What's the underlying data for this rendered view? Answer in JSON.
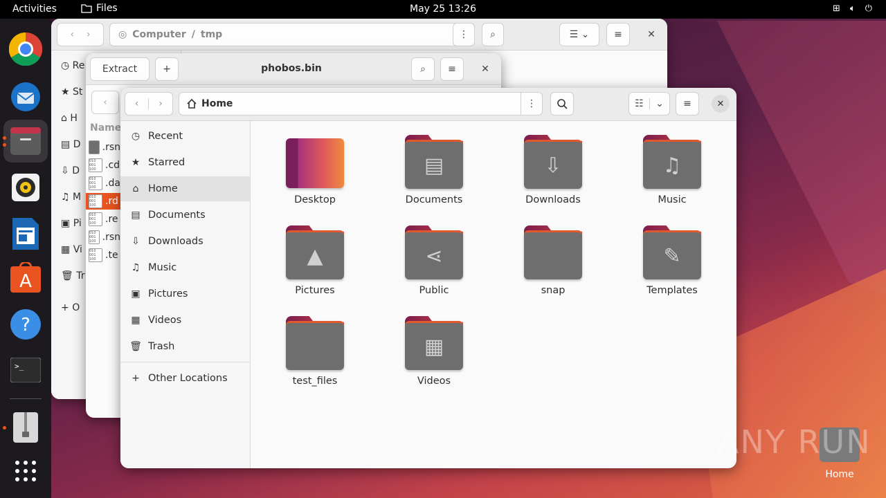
{
  "topbar": {
    "activities": "Activities",
    "app_name": "Files",
    "clock": "May 25  13:26"
  },
  "dock": {
    "items": [
      {
        "name": "chrome"
      },
      {
        "name": "thunderbird"
      },
      {
        "name": "files"
      },
      {
        "name": "rhythmbox"
      },
      {
        "name": "libreoffice-writer"
      },
      {
        "name": "app-center"
      },
      {
        "name": "help"
      },
      {
        "name": "terminal"
      },
      {
        "name": "archive-manager"
      },
      {
        "name": "show-apps"
      }
    ]
  },
  "back_window": {
    "path": [
      "Computer",
      "tmp"
    ],
    "sidebar_partial": [
      "Re",
      "St",
      "H",
      "D",
      "D",
      "M",
      "Pi",
      "Vi",
      "Tr",
      "O"
    ]
  },
  "archive_window": {
    "extract_label": "Extract",
    "title": "phobos.bin",
    "column_header": "Name",
    "files": [
      ".rsn",
      ".cd",
      ".da",
      ".rd",
      ".re",
      ".rsn",
      ".te"
    ]
  },
  "files_window": {
    "location": "Home",
    "sidebar": [
      {
        "label": "Recent",
        "icon": "recent-icon"
      },
      {
        "label": "Starred",
        "icon": "star-icon"
      },
      {
        "label": "Home",
        "icon": "home-icon",
        "selected": true
      },
      {
        "label": "Documents",
        "icon": "document-icon"
      },
      {
        "label": "Downloads",
        "icon": "download-icon"
      },
      {
        "label": "Music",
        "icon": "music-icon"
      },
      {
        "label": "Pictures",
        "icon": "picture-icon"
      },
      {
        "label": "Videos",
        "icon": "video-icon"
      },
      {
        "label": "Trash",
        "icon": "trash-icon"
      }
    ],
    "other_locations": "Other Locations",
    "folders": [
      "Desktop",
      "Documents",
      "Downloads",
      "Music",
      "Pictures",
      "Public",
      "snap",
      "Templates",
      "test_files",
      "Videos"
    ]
  },
  "desktop": {
    "home_label": "Home"
  },
  "watermark": "ANY RUN"
}
